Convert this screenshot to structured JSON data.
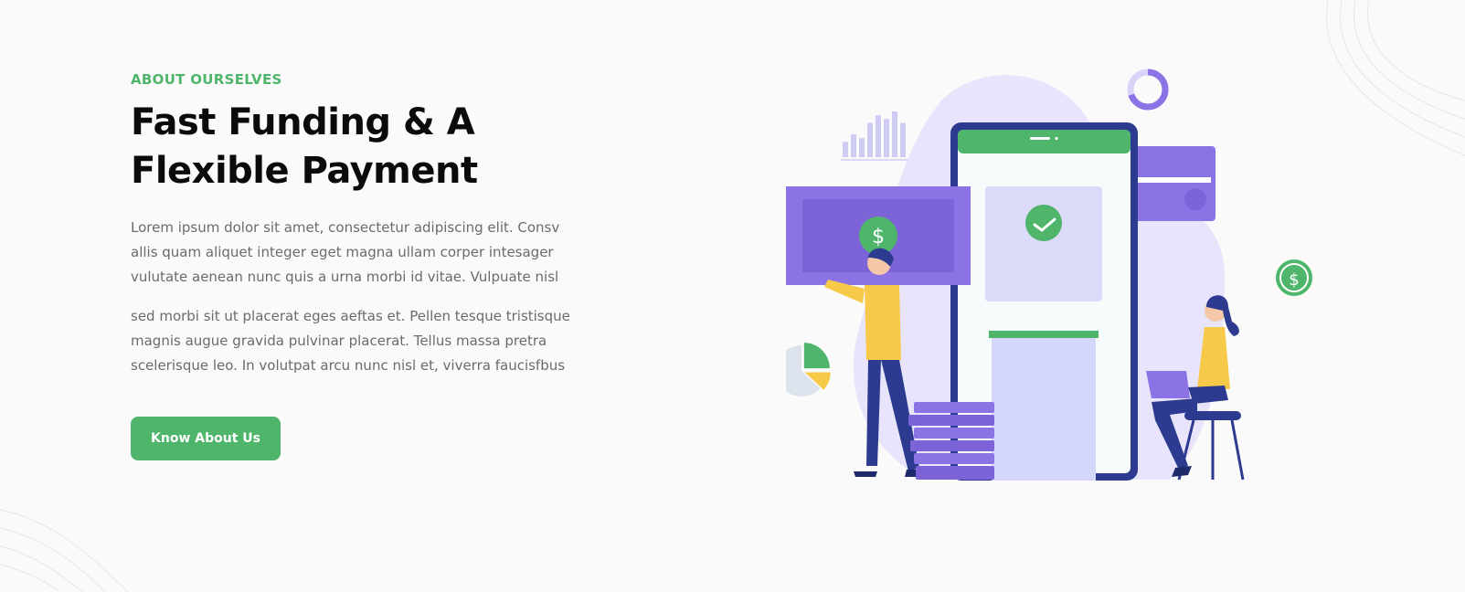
{
  "section": {
    "eyebrow": "ABOUT OURSELVES",
    "title": "Fast Funding & A Flexible Payment",
    "paragraph_1": "Lorem ipsum dolor sit amet, consectetur adipiscing elit. Consv allis quam aliquet integer eget magna ullam corper intesager vulutate aenean nunc quis a urna morbi id vitae. Vulpuate nisl",
    "paragraph_2": "sed morbi sit ut placerat eges aeftas et. Pellen tesque tristisque magnis augue gravida pulvinar placerat. Tellus massa pretra scelerisque leo. In volutpat arcu nunc nisl et, viverra faucisfbus",
    "cta_label": "Know About Us"
  },
  "illustration": {
    "dollar_symbol": "$",
    "pie_chart": {
      "slices": [
        {
          "value": 0.25,
          "color": "#4fb56b"
        },
        {
          "value": 0.12,
          "color": "#f7c948"
        },
        {
          "value": 0.63,
          "color": "#dde3ec"
        }
      ]
    },
    "bar_chart": {
      "values": [
        4,
        6,
        5,
        9,
        11,
        10,
        12,
        9
      ]
    },
    "donut_progress": 0.7
  },
  "colors": {
    "accent_green": "#4fb56b",
    "primary_purple": "#8b73e6",
    "navy": "#2c3b8f",
    "yellow": "#f7c948",
    "text_dark": "#0b0b0b",
    "text_gray": "#6b6b6b",
    "background": "#fafafa"
  }
}
